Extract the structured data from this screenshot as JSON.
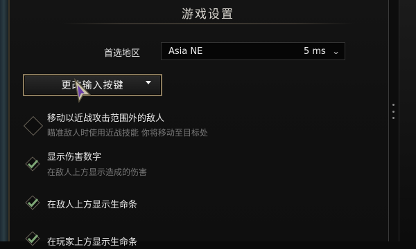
{
  "window": {
    "title": "游戏设置"
  },
  "region": {
    "label": "首选地区",
    "selected": "Asia NE",
    "ping": "5 ms"
  },
  "keybind": {
    "label": "更改输入按键"
  },
  "options": [
    {
      "title": "移动以近战攻击范围外的敌人",
      "description": "瞄准敌人时使用近战技能 你将移动至目标处",
      "checked": false
    },
    {
      "title": "显示伤害数字",
      "description": "在敌人上方显示造成的伤害",
      "checked": true
    },
    {
      "title": "在敌人上方显示生命条",
      "description": "",
      "checked": true
    },
    {
      "title": "在玩家上方显示生命条",
      "description": "",
      "checked": true
    }
  ],
  "colors": {
    "accent_gold": "#8a7a5c",
    "check_green": "#7fa877",
    "cursor_purple": "#6b3fa8"
  },
  "icons": {
    "dropdown": "chevron-down-icon",
    "checked": "checkmark-icon",
    "unchecked": "empty-diamond-icon",
    "cursor": "mouse-cursor-icon"
  }
}
